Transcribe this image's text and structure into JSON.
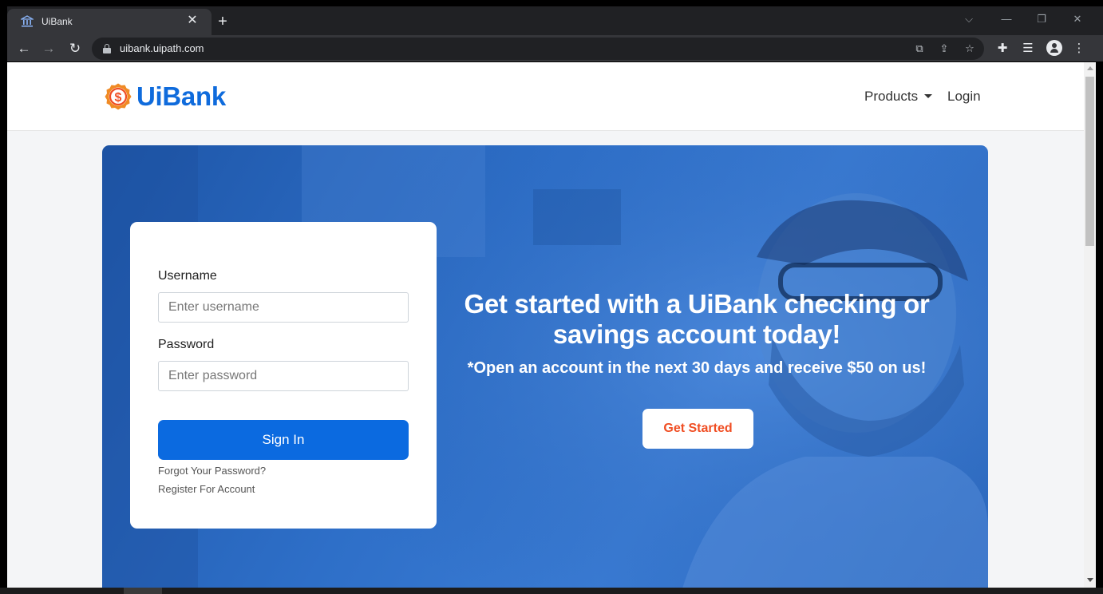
{
  "browser": {
    "tab_title": "UiBank",
    "tab_icon": "bank-icon",
    "url": "uibank.uipath.com"
  },
  "navbar": {
    "logo_text": "UiBank",
    "logo_icon": "dollar-badge-icon",
    "products_label": "Products",
    "login_label": "Login"
  },
  "login_form": {
    "username_label": "Username",
    "username_placeholder": "Enter username",
    "username_value": "",
    "password_label": "Password",
    "password_placeholder": "Enter password",
    "password_value": "",
    "signin_label": "Sign In",
    "forgot_label": "Forgot Your Password?",
    "register_label": "Register For Account"
  },
  "hero": {
    "headline": "Get started with a UiBank checking or savings account today!",
    "subtext": "*Open an account in the next 30 days and receive $50 on us!",
    "cta_label": "Get Started"
  },
  "colors": {
    "brand_blue": "#0f6bdc",
    "brand_orange": "#f04e23",
    "button_blue": "#0b6ae0",
    "hero_blue": "#2e6fc8"
  }
}
